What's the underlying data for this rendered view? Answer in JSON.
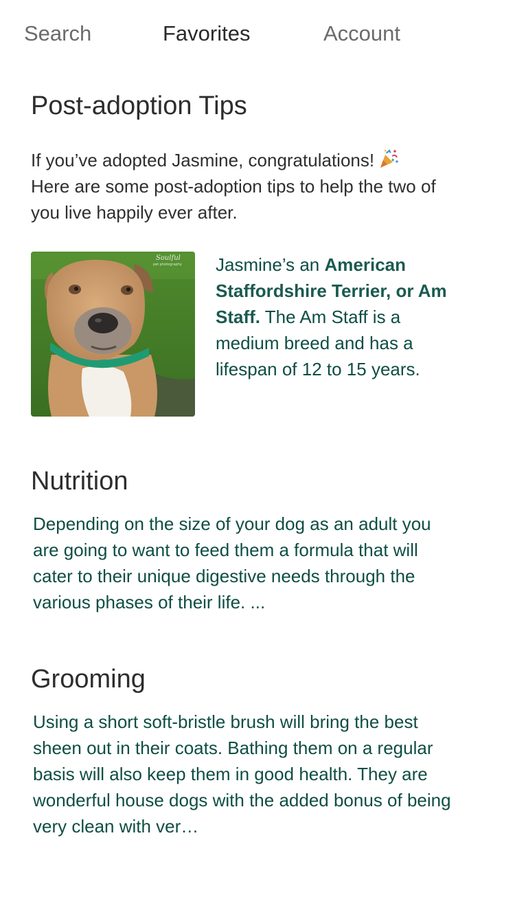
{
  "tabs": [
    {
      "label": "Search",
      "active": false
    },
    {
      "label": "Favorites",
      "active": true
    },
    {
      "label": "Account",
      "active": false
    }
  ],
  "page_title": "Post-adoption Tips",
  "intro_text": "If you’ve adopted Jasmine, congratulations!",
  "intro_text_2": "Here are some post-adoption tips to help the two of you live happily ever after.",
  "intro_icon": "party-popper-icon",
  "breed": {
    "photo_alt": "Jasmine",
    "photo_watermark": "Soulful pet photography",
    "text_prefix": "Jasmine’s an ",
    "breed_name": "American Staffordshire Terrier, or Am Staff.",
    "text_suffix": " The Am Staff is a medium breed and has a lifespan of 12 to 15 years."
  },
  "sections": {
    "nutrition": {
      "title": "Nutrition",
      "body": "Depending on the size of your dog as an adult you are going to want to feed them a formula that will cater to their unique digestive needs through the various phases of their life. ..."
    },
    "grooming": {
      "title": "Grooming",
      "body": "Using a short soft-bristle brush will bring the best sheen out in their coats. Bathing them on a regular basis will also keep them in good health. They are wonderful house dogs with the added bonus of being very clean with ver…"
    }
  },
  "colors": {
    "accent_text": "#0f4e44",
    "heading": "#2d2d2d",
    "tab_inactive": "#6b6b6b"
  }
}
